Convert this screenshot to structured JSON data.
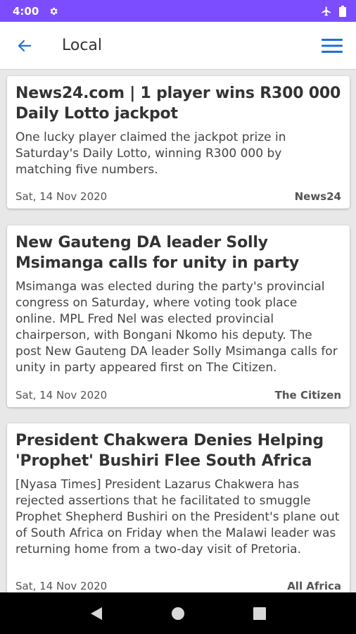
{
  "status_bar": {
    "time": "4:00",
    "icons": [
      "gear-icon",
      "airplane-icon",
      "battery-icon"
    ]
  },
  "app_bar": {
    "title": "Local",
    "back_icon": "arrow-left-icon",
    "menu_icon": "hamburger-menu-icon",
    "accent": "#1e6fe0"
  },
  "articles": [
    {
      "title": "News24.com | 1 player wins R300 000 Daily Lotto jackpot",
      "summary": "One lucky player claimed the jackpot prize in Saturday's Daily Lotto, winning R300 000 by matching five numbers.",
      "date": "Sat, 14 Nov 2020",
      "source": "News24"
    },
    {
      "title": "New Gauteng DA leader Solly Msimanga calls for unity in party",
      "summary": "Msimanga was elected during the party's provincial congress on Saturday, where voting took place online. MPL Fred Nel was elected provincial chairperson, with Bongani Nkomo his deputy. The post New Gauteng DA leader Solly Msimanga calls for unity in party appeared first on The Citizen.",
      "date": "Sat, 14 Nov 2020",
      "source": "The Citizen"
    },
    {
      "title": "President Chakwera Denies Helping 'Prophet' Bushiri Flee South Africa",
      "summary": "[Nyasa Times] President Lazarus Chakwera has rejected assertions that he facilitated to smuggle Prophet Shepherd Bushiri on the President's plane out of South Africa on Friday when the Malawi leader was returning home from a two-day visit of Pretoria.",
      "date": "Sat, 14 Nov 2020",
      "source": "All Africa"
    }
  ],
  "nav_bar": {
    "icons": [
      "back-triangle-icon",
      "home-circle-icon",
      "recents-square-icon"
    ]
  }
}
